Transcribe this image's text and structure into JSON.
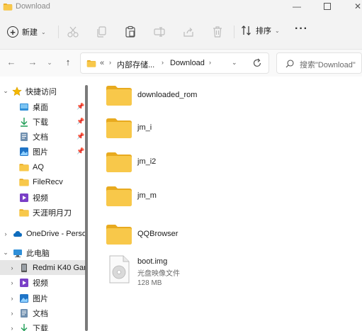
{
  "window": {
    "title": "Download"
  },
  "toolbar": {
    "new_label": "新建",
    "sort_label": "排序"
  },
  "address": {
    "prefix": "«",
    "segments": [
      "内部存储...",
      "Download"
    ]
  },
  "search": {
    "placeholder": "搜索\"Download\""
  },
  "sidebar": {
    "quick_access": {
      "label": "快捷访问",
      "items": [
        {
          "label": "桌面",
          "icon": "desktop-icon",
          "pinned": true
        },
        {
          "label": "下载",
          "icon": "download-icon",
          "pinned": true
        },
        {
          "label": "文档",
          "icon": "document-icon",
          "pinned": true
        },
        {
          "label": "图片",
          "icon": "picture-icon",
          "pinned": true
        },
        {
          "label": "AQ",
          "icon": "folder-icon",
          "pinned": false
        },
        {
          "label": "FileRecv",
          "icon": "folder-icon",
          "pinned": false
        },
        {
          "label": "视频",
          "icon": "video-icon",
          "pinned": false
        },
        {
          "label": "天涯明月刀",
          "icon": "folder-icon",
          "pinned": false
        }
      ]
    },
    "onedrive": {
      "label": "OneDrive - Perso"
    },
    "this_pc": {
      "label": "此电脑",
      "items": [
        {
          "label": "Redmi K40 Gar",
          "icon": "phone-icon",
          "selected": true
        },
        {
          "label": "视频",
          "icon": "video-icon"
        },
        {
          "label": "图片",
          "icon": "picture-icon"
        },
        {
          "label": "文档",
          "icon": "document-icon"
        },
        {
          "label": "下载",
          "icon": "download-icon"
        }
      ]
    }
  },
  "content": {
    "folders": [
      {
        "name": "downloaded_rom"
      },
      {
        "name": "jm_i"
      },
      {
        "name": "jm_i2"
      },
      {
        "name": "jm_m"
      },
      {
        "name": "QQBrowser"
      }
    ],
    "file": {
      "name": "boot.img",
      "type": "光盘映像文件",
      "size": "128 MB"
    }
  },
  "colors": {
    "folder": "#f5c342",
    "folder_back": "#e8aa1f",
    "accent": "#0067c0"
  }
}
